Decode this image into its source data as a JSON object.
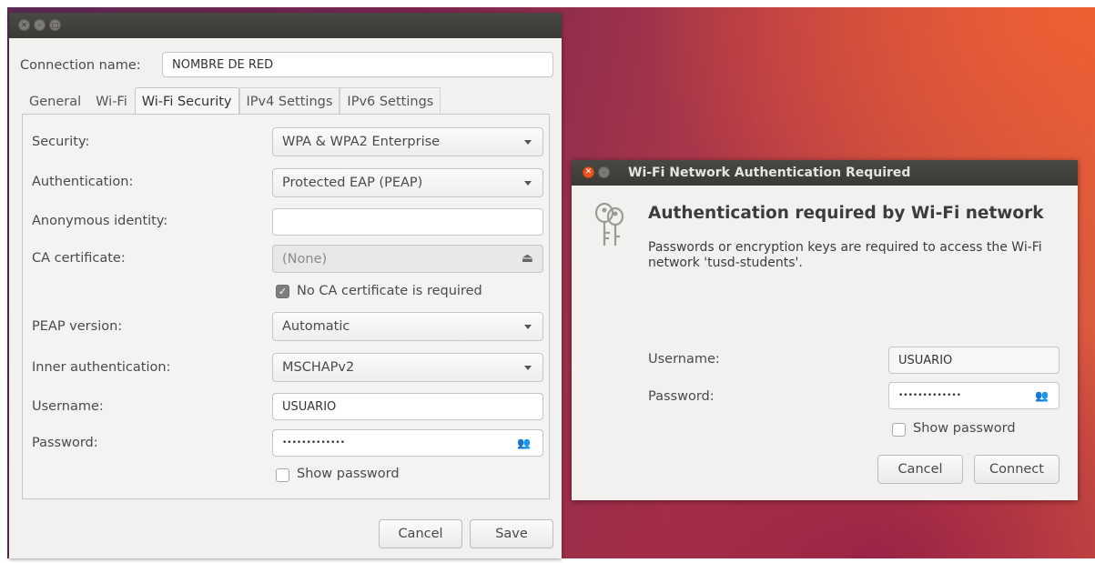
{
  "left_window": {
    "connection_name_label": "Connection name:",
    "connection_name_value": "NOMBRE DE RED",
    "tabs": [
      "General",
      "Wi-Fi",
      "Wi-Fi Security",
      "IPv4 Settings",
      "IPv6 Settings"
    ],
    "active_tab": "Wi-Fi Security",
    "security_label": "Security:",
    "security_value": "WPA & WPA2 Enterprise",
    "authentication_label": "Authentication:",
    "authentication_value": "Protected EAP (PEAP)",
    "anonymous_identity_label": "Anonymous identity:",
    "anonymous_identity_value": "",
    "ca_certificate_label": "CA certificate:",
    "ca_certificate_value": "(None)",
    "no_ca_checkbox_label": "No CA certificate is required",
    "no_ca_checked": true,
    "peap_version_label": "PEAP version:",
    "peap_version_value": "Automatic",
    "inner_auth_label": "Inner authentication:",
    "inner_auth_value": "MSCHAPv2",
    "username_label": "Username:",
    "username_value": "USUARIO",
    "password_label": "Password:",
    "password_value": "•••••••••••••",
    "show_password_label": "Show password",
    "cancel_label": "Cancel",
    "save_label": "Save"
  },
  "right_dialog": {
    "title": "Wi-Fi Network Authentication Required",
    "heading": "Authentication required by Wi-Fi network",
    "message": "Passwords or encryption keys are required to access the Wi-Fi network 'tusd-students'.",
    "username_label": "Username:",
    "username_value": "USUARIO",
    "password_label": "Password:",
    "password_value": "•••••••••••••",
    "show_password_label": "Show password",
    "cancel_label": "Cancel",
    "connect_label": "Connect"
  },
  "icons": {
    "window_close": "close-icon",
    "keys": "keys-icon",
    "certificate_picker": "file-icon",
    "password_options": "users-icon"
  },
  "colors": {
    "ubuntu_orange": "#e95420",
    "titlebar": "#3b3935"
  }
}
